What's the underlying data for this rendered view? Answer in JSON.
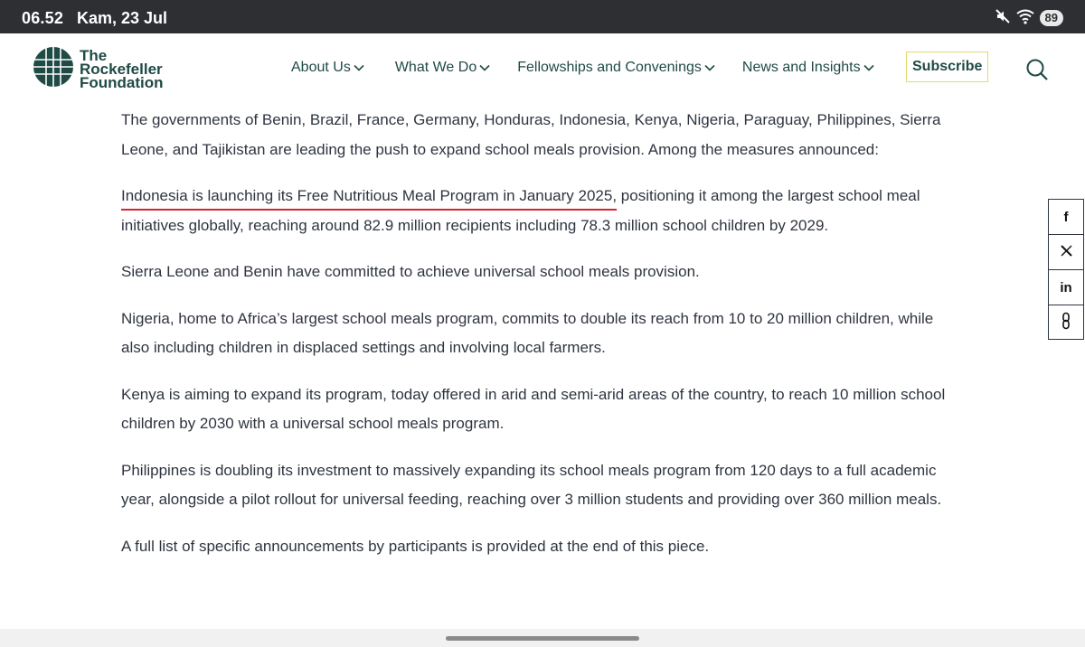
{
  "status_bar": {
    "time": "06.52",
    "date": "Kam, 23 Jul",
    "battery": "89",
    "icons": [
      "mute-icon",
      "wifi-icon"
    ]
  },
  "header": {
    "logo_lines": [
      "The",
      "Rockefeller",
      "Foundation"
    ],
    "nav": [
      {
        "label": "About Us"
      },
      {
        "label": "What We Do"
      },
      {
        "label": "Fellowships and Convenings"
      },
      {
        "label": "News and Insights"
      }
    ],
    "subscribe_label": "Subscribe",
    "colors": {
      "brand": "#1f4a45",
      "subscribe_border": "#e3da6c"
    }
  },
  "article": {
    "paragraph_1": "The governments of Benin, Brazil, France, Germany, Honduras, Indonesia, Kenya, Nigeria, Paraguay, Philippines, Sierra Leone, and Tajikistan are leading the push to expand school meals provision. Among the measures announced:",
    "paragraph_2_highlight": "Indonesia is launching its Free Nutritious Meal Program in January 2025,",
    "paragraph_2_rest": " positioning it among the largest school meal initiatives globally, reaching around 82.9 million recipients including 78.3 million school children by 2029.",
    "paragraph_3": "Sierra Leone and Benin have committed to achieve universal school meals provision.",
    "paragraph_4": "Nigeria, home to Africa’s largest school meals program, commits to double its reach from 10 to 20 million children, while also including children in displaced settings and involving local farmers.",
    "paragraph_5": "Kenya is aiming to expand its program, today offered in arid and semi-arid areas of the country, to reach 10 million school children by 2030 with a universal school meals program.",
    "paragraph_6": "Philippines is doubling its investment to massively expanding its school meals program from 120 days to a full academic year, alongside a pilot rollout for universal feeding, reaching over 3 million students and providing over 360 million meals.",
    "paragraph_7": "A full list of specific announcements by participants is provided at the end of this piece.",
    "highlight_color": "#d9232d",
    "text_color": "#2f3540"
  },
  "share": [
    {
      "icon": "facebook-icon",
      "glyph": "f"
    },
    {
      "icon": "x-icon",
      "glyph": "𝕏"
    },
    {
      "icon": "linkedin-icon",
      "glyph": "in"
    },
    {
      "icon": "link-icon",
      "glyph": "🔗"
    }
  ]
}
